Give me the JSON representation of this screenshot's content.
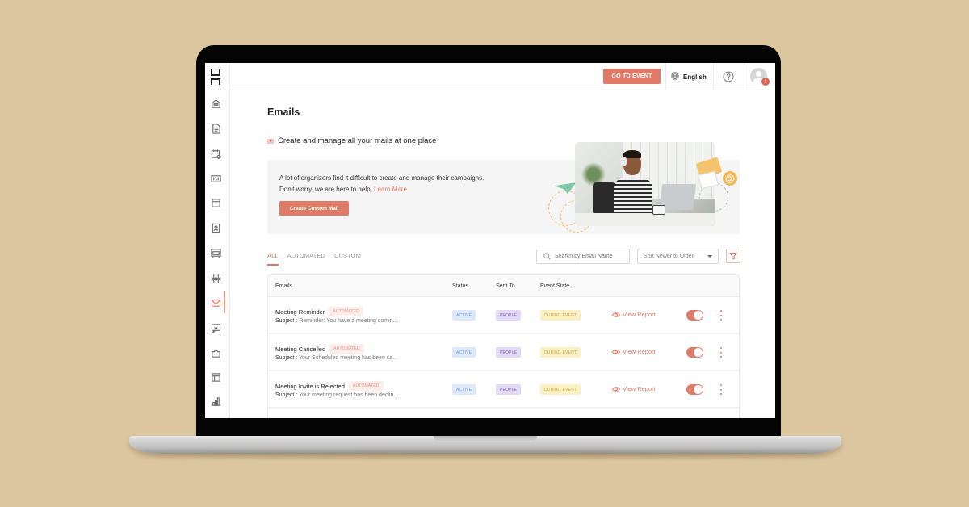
{
  "header": {
    "go_to_event_label": "GO TO EVENT",
    "language": "English",
    "help_icon": "question-circle-icon",
    "avatar_badge": "!"
  },
  "sidebar": {
    "logo": "brand-logo",
    "items": [
      {
        "icon": "building-icon",
        "active": false
      },
      {
        "icon": "document-icon",
        "active": false
      },
      {
        "icon": "calendar-icon",
        "active": false
      },
      {
        "icon": "badge-icon",
        "active": false
      },
      {
        "icon": "booth-icon",
        "active": false
      },
      {
        "icon": "id-card-icon",
        "active": false
      },
      {
        "icon": "lounge-icon",
        "active": false
      },
      {
        "icon": "networking-icon",
        "active": false
      },
      {
        "icon": "mail-icon",
        "active": true
      },
      {
        "icon": "chat-icon",
        "active": false
      },
      {
        "icon": "puzzle-icon",
        "active": false
      },
      {
        "icon": "layout-icon",
        "active": false
      },
      {
        "icon": "bar-chart-icon",
        "active": false
      }
    ]
  },
  "main": {
    "title": "Emails",
    "subtitle": "Create and manage all your mails at one place",
    "banner": {
      "text": "A lot of organizers find it difficult to create and manage their campaigns. Don't worry, we are here to help.",
      "learn_more": "Learn More",
      "cta_label": "Create Custom Mail"
    },
    "tabs": [
      {
        "label": "ALL",
        "active": true
      },
      {
        "label": "AUTOMATED",
        "active": false
      },
      {
        "label": "CUSTOM",
        "active": false
      }
    ],
    "search": {
      "placeholder": "Search by Email Name",
      "value": ""
    },
    "sort": {
      "selected": "Sort Newer to Older"
    },
    "table": {
      "columns": [
        "Emails",
        "Status",
        "Sent To",
        "Event State"
      ],
      "rows": [
        {
          "name": "Meeting Reminder",
          "tag": "AUTOMATED",
          "subject_label": "Subject :",
          "subject": "Reminder: You have a meeting comin...",
          "status": "ACTIVE",
          "sent_to": "PEOPLE",
          "event_state": "DURING EVENT",
          "action": "View Report",
          "enabled": true
        },
        {
          "name": "Meeting Cancelled",
          "tag": "AUTOMATED",
          "subject_label": "Subject :",
          "subject": "Your Scheduled meeting has been ca...",
          "status": "ACTIVE",
          "sent_to": "PEOPLE",
          "event_state": "DURING EVENT",
          "action": "View Report",
          "enabled": true
        },
        {
          "name": "Meeting Invite is Rejected",
          "tag": "AUTOMATED",
          "subject_label": "Subject :",
          "subject": "Your meeting request has been declin...",
          "status": "ACTIVE",
          "sent_to": "PEOPLE",
          "event_state": "DURING EVENT",
          "action": "View Report",
          "enabled": true
        }
      ]
    }
  },
  "colors": {
    "accent": "#e07a68",
    "background": "#dcc6a0",
    "status_active": "#dde9fb",
    "sent_people": "#e3d9f6",
    "event_during": "#fbefc4"
  }
}
